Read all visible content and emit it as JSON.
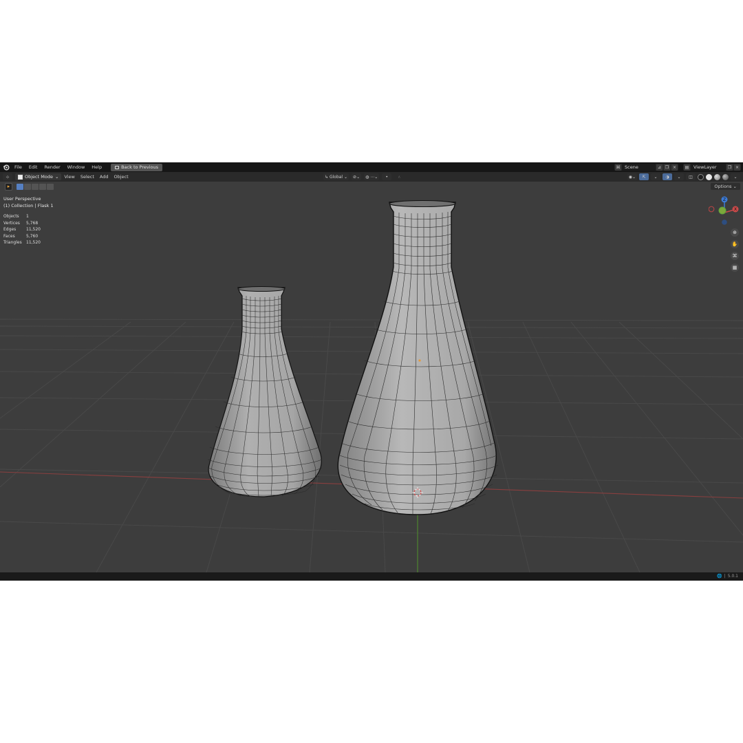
{
  "menu": {
    "items": [
      "File",
      "Edit",
      "Render",
      "Window",
      "Help"
    ],
    "back_button": "Back to Previous"
  },
  "scene": {
    "name": "Scene"
  },
  "view_layer": {
    "name": "ViewLayer"
  },
  "header": {
    "mode": "Object Mode",
    "menus": [
      "View",
      "Select",
      "Add",
      "Object"
    ],
    "orientation": "Global",
    "options_label": "Options"
  },
  "viewport": {
    "perspective_label": "User Perspective",
    "collection_label": "(1) Collection | Flask 1",
    "stats": [
      {
        "label": "Objects",
        "value": "1"
      },
      {
        "label": "Vertices",
        "value": "5,768"
      },
      {
        "label": "Edges",
        "value": "11,520"
      },
      {
        "label": "Faces",
        "value": "5,760"
      },
      {
        "label": "Triangles",
        "value": "11,520"
      }
    ],
    "gizmo_axes": [
      "Z",
      "X",
      "Y"
    ]
  },
  "status": {
    "version": "5.0.1"
  },
  "colors": {
    "x_axis": "#c94a4a",
    "y_axis": "#5fa33b",
    "z_axis": "#3d7bd6",
    "mesh_fill": "#9a9a9a",
    "wire": "#1b1b1b",
    "viewport_bg": "#3d3d3d"
  },
  "icons": [
    "blender-logo-icon",
    "back-icon",
    "editor-type-icon",
    "object-mode-icon",
    "transform-orientation-icon",
    "pivot-icon",
    "snap-icon",
    "proportional-edit-icon",
    "visibility-icon",
    "gizmo-icon",
    "overlay-icon",
    "xray-icon",
    "wireframe-shading-icon",
    "solid-shading-icon",
    "material-shading-icon",
    "rendered-shading-icon",
    "zoom-icon",
    "pan-hand-icon",
    "camera-icon",
    "grid-ortho-icon",
    "globe-icon"
  ]
}
